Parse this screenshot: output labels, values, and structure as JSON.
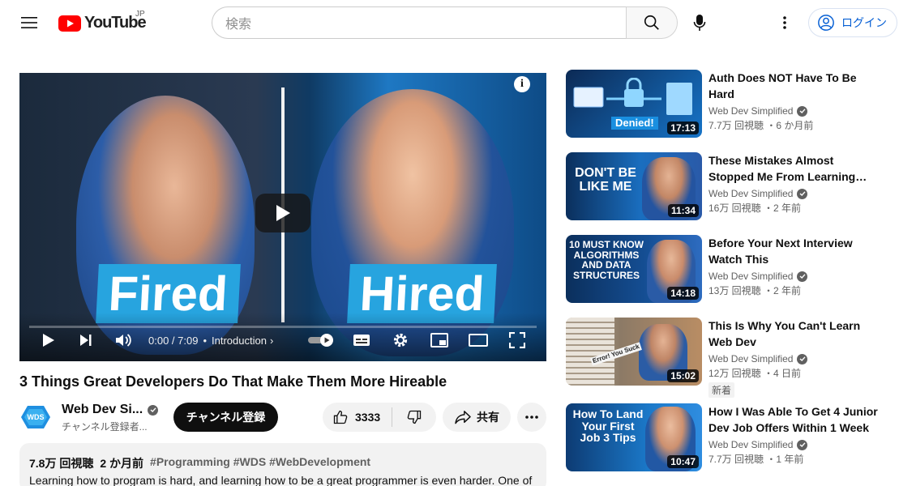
{
  "header": {
    "logo_text": "YouTube",
    "region": "JP",
    "search_placeholder": "検索",
    "login_label": "ログイン"
  },
  "player": {
    "left_word": "Fired",
    "right_word": "Hired",
    "time": "0:00 / 7:09",
    "chapter": "Introduction",
    "progress": 0
  },
  "video": {
    "title": "3 Things Great Developers Do That Make Them More Hireable",
    "channel_name": "Web Dev Si...",
    "channel_avatar_text": "WDS",
    "subscribers": "チャンネル登録者...",
    "subscribe_label": "チャンネル登録",
    "likes": "3333",
    "share_label": "共有"
  },
  "description": {
    "views": "7.8万 回視聴",
    "age": "2 か月前",
    "tags": "#Programming #WDS #WebDevelopment",
    "text": "Learning how to program is hard, and learning how to be a great programmer is even harder. One of"
  },
  "recommendations": [
    {
      "title": "Auth Does NOT Have To Be Hard",
      "channel": "Web Dev Simplified",
      "stats": "7.7万 回視聴 ・6 か月前",
      "duration": "17:13",
      "thumb_text": "Denied!",
      "badge": ""
    },
    {
      "title": "These Mistakes Almost Stopped Me From Learning To...",
      "channel": "Web Dev Simplified",
      "stats": "16万 回視聴 ・2 年前",
      "duration": "11:34",
      "thumb_text": "DON'T BE LIKE ME",
      "badge": ""
    },
    {
      "title": "Before Your Next Interview Watch This",
      "channel": "Web Dev Simplified",
      "stats": "13万 回視聴 ・2 年前",
      "duration": "14:18",
      "thumb_text": "10 MUST KNOW ALGORITHMS AND DATA STRUCTURES",
      "badge": ""
    },
    {
      "title": "This Is Why You Can't Learn Web Dev",
      "channel": "Web Dev Simplified",
      "stats": "12万 回視聴 ・4 日前",
      "duration": "15:02",
      "thumb_text": "Error! You Suck",
      "badge": "新着"
    },
    {
      "title": "How I Was Able To Get 4 Junior Dev Job Offers Within 1 Week",
      "channel": "Web Dev Simplified",
      "stats": "7.7万 回視聴 ・1 年前",
      "duration": "10:47",
      "thumb_text": "How To Land Your First Job 3 Tips",
      "badge": ""
    }
  ]
}
